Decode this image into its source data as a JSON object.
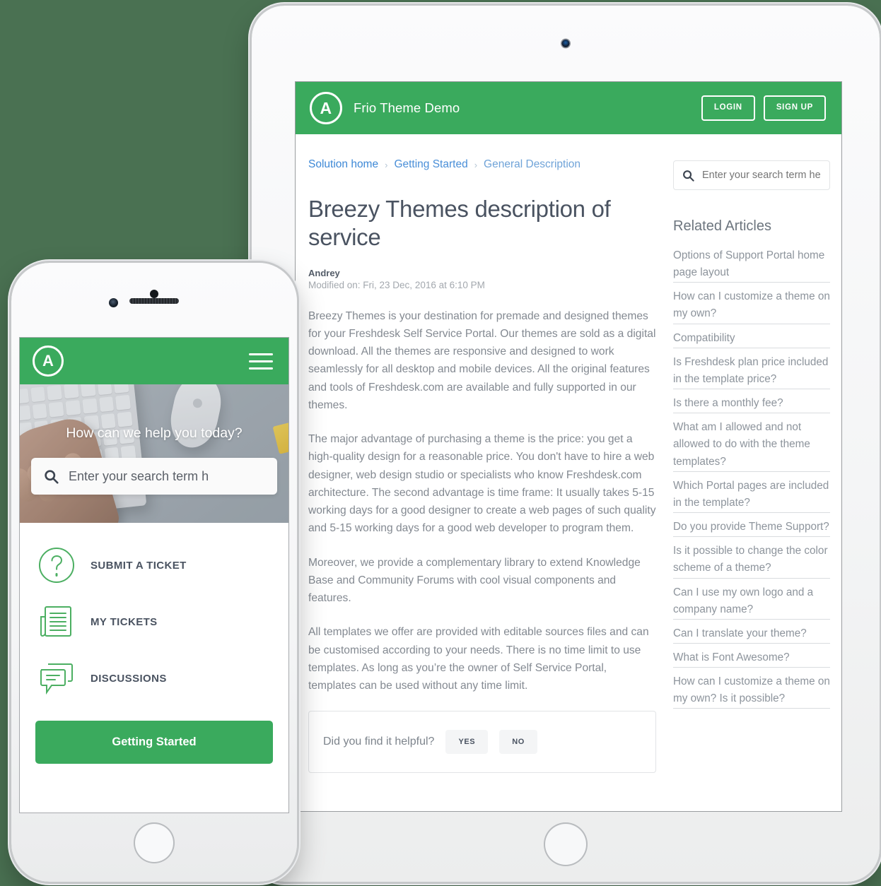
{
  "page": {
    "background_color": "#4a7152",
    "brand_green": "#3aaa5d"
  },
  "tablet": {
    "header": {
      "logo_letter": "A",
      "logo_icon": "circle-a-logo-icon",
      "title": "Frio Theme Demo",
      "login_label": "LOGIN",
      "signup_label": "SIGN UP"
    },
    "search": {
      "icon": "search-icon",
      "placeholder": "Enter your search term her",
      "value": ""
    },
    "breadcrumb": [
      {
        "label": "Solution home"
      },
      {
        "label": "Getting Started"
      },
      {
        "label": "General Description"
      }
    ],
    "breadcrumb_separator": "›",
    "article": {
      "title": "Breezy Themes description of service",
      "author": "Andrey",
      "modified": "Modified on: Fri, 23 Dec, 2016 at 6:10 PM",
      "paragraphs": [
        "Breezy Themes is your destination for premade and designed themes for your Freshdesk Self Service Portal. Our themes are sold as a digital download. All the themes are responsive and designed to work seamlessly for all desktop and mobile devices. All the original features and tools of Freshdesk.com are available and fully supported in our themes.",
        "The major advantage of purchasing a theme is the price: you get a high-quality design for a reasonable price. You don't have to hire a web designer, web design studio or specialists who know Freshdesk.com architecture. The second advantage is time frame: It usually takes 5-15 working days for a good designer to create a web pages of such quality and 5-15 working days for a good web developer to program them.",
        "Moreover, we provide a complementary library to extend Knowledge Base and Community Forums with cool visual components and features.",
        "All templates we offer are provided with editable sources files and can be customised according to your needs. There is no time limit to use templates. As long as you’re the owner of Self Service Portal, templates can be used without any time limit."
      ]
    },
    "feedback": {
      "question": "Did you find it helpful?",
      "yes_label": "YES",
      "no_label": "NO"
    },
    "related": {
      "title": "Related Articles",
      "links": [
        "Options of Support Portal home page layout",
        "How can I customize a theme on my own?",
        "Compatibility",
        "Is Freshdesk plan price included in the template price?",
        "Is there a monthly fee?",
        "What am I allowed and not allowed to do with the theme templates?",
        "Which Portal pages are included in the template?",
        "Do you provide Theme Support?",
        "Is it possible to change the color scheme of a theme?",
        "Can I use my own logo and a company name?",
        "Can I translate your theme?",
        "What is Font Awesome?",
        "How can I customize a theme on my own? Is it possible?"
      ]
    }
  },
  "phone": {
    "header": {
      "logo_letter": "A",
      "logo_icon": "circle-a-logo-icon",
      "menu_icon": "hamburger-menu-icon"
    },
    "hero": {
      "heading": "How can we help you today?",
      "search_icon": "search-icon",
      "search_placeholder": "Enter your search term h",
      "search_value": ""
    },
    "menu": [
      {
        "label": "SUBMIT A TICKET",
        "icon": "question-circle-icon"
      },
      {
        "label": "MY TICKETS",
        "icon": "document-pages-icon"
      },
      {
        "label": "DISCUSSIONS",
        "icon": "chat-bubbles-icon"
      }
    ],
    "cta_label": "Getting Started"
  }
}
